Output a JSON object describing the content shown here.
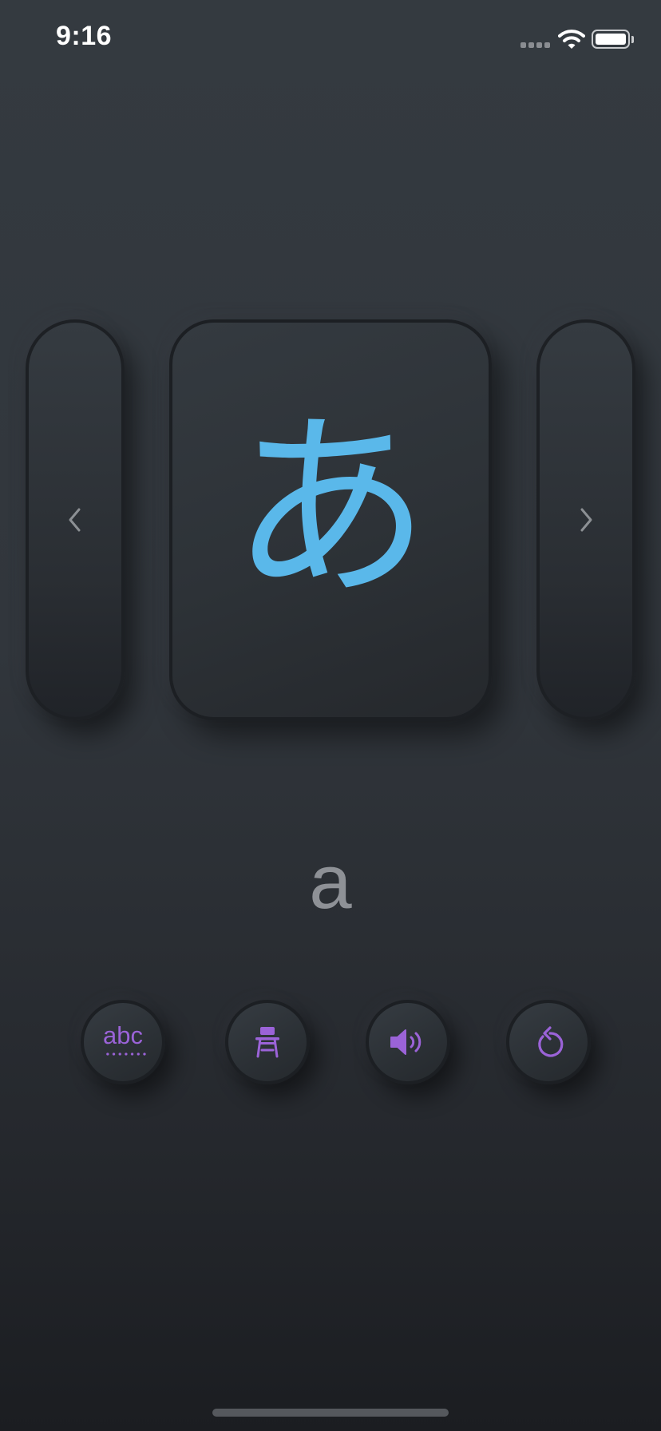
{
  "status_bar": {
    "time": "9:16"
  },
  "card": {
    "kana": "あ",
    "romaji": "a"
  },
  "buttons": {
    "romaji_toggle_label": "abc"
  },
  "colors": {
    "accent": "#9b63d8",
    "kana": "#5ab8ea",
    "romaji": "#8e9196",
    "chevron": "#8c9094"
  },
  "icons": {
    "previous": "chevron-left-icon",
    "next": "chevron-right-icon",
    "romaji": "abc-icon",
    "study": "desk-chair-icon",
    "sound": "speaker-icon",
    "replay": "replay-icon"
  }
}
